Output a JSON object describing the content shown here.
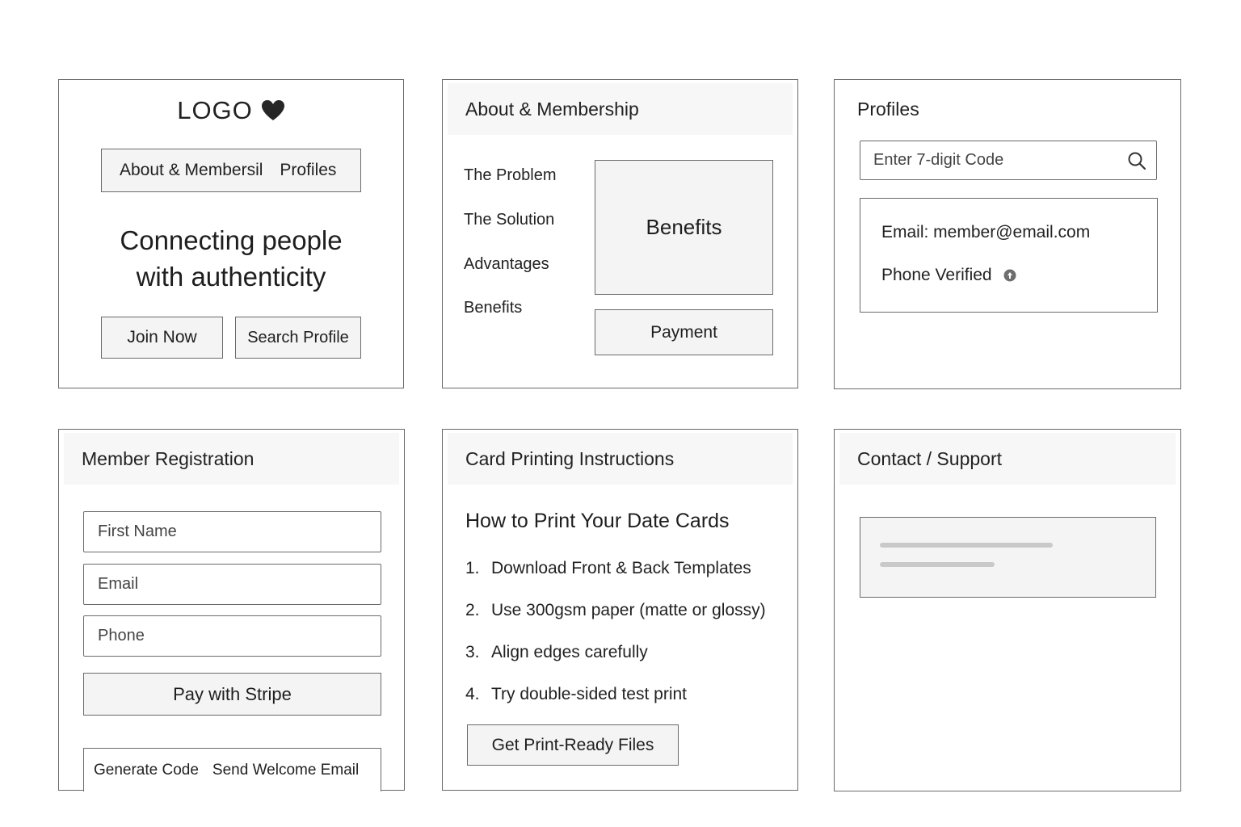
{
  "home": {
    "logo_text": "LOGO",
    "logo_icon": "heart-icon",
    "nav": [
      "About & Membersil",
      "Profiles"
    ],
    "headline_line1": "Connecting people",
    "headline_line2": "with authenticity",
    "join_label": "Join Now",
    "search_label": "Search Profile"
  },
  "about": {
    "title": "About & Membership",
    "menu": [
      "The Problem",
      "The Solution",
      "Advantages",
      "Benefits"
    ],
    "benefits_box": "Benefits",
    "payment_label": "Payment"
  },
  "profiles": {
    "title": "Profiles",
    "search_placeholder": "Enter 7-digit Code",
    "search_icon": "search-icon",
    "email_line": "Email: member@email.com",
    "phone_line": "Phone Verified",
    "verified_icon": "verified-icon"
  },
  "registration": {
    "title": "Member Registration",
    "first_name_placeholder": "First Name",
    "email_placeholder": "Email",
    "phone_placeholder": "Phone",
    "pay_label": "Pay with Stripe",
    "generate_label": "Generate Code",
    "welcome_label": "Send Welcome Email"
  },
  "printing": {
    "title": "Card Printing Instructions",
    "heading": "How to Print Your Date Cards",
    "steps": [
      {
        "num": "1.",
        "text": "Download Front & Back Templates"
      },
      {
        "num": "2.",
        "text": "Use 300gsm paper (matte or glossy)"
      },
      {
        "num": "3.",
        "text": "Align edges carefully"
      },
      {
        "num": "4.",
        "text": "Try double-sided test print"
      }
    ],
    "files_label": "Get Print-Ready Files"
  },
  "contact": {
    "title": "Contact / Support"
  }
}
